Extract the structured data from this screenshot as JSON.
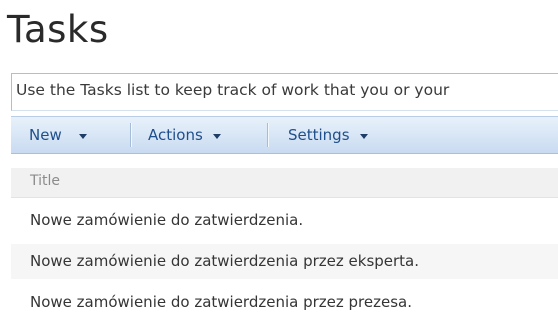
{
  "page": {
    "title": "Tasks",
    "description": "Use the Tasks list to keep track of work that you or your"
  },
  "toolbar": {
    "new_label": "New",
    "actions_label": "Actions",
    "settings_label": "Settings"
  },
  "list": {
    "columns": [
      "Title"
    ],
    "rows": [
      {
        "title": "Nowe zamówienie do zatwierdzenia."
      },
      {
        "title": "Nowe zamówienie do zatwierdzenia przez eksperta."
      },
      {
        "title": "Nowe zamówienie do zatwierdzenia przez prezesa."
      }
    ]
  }
}
